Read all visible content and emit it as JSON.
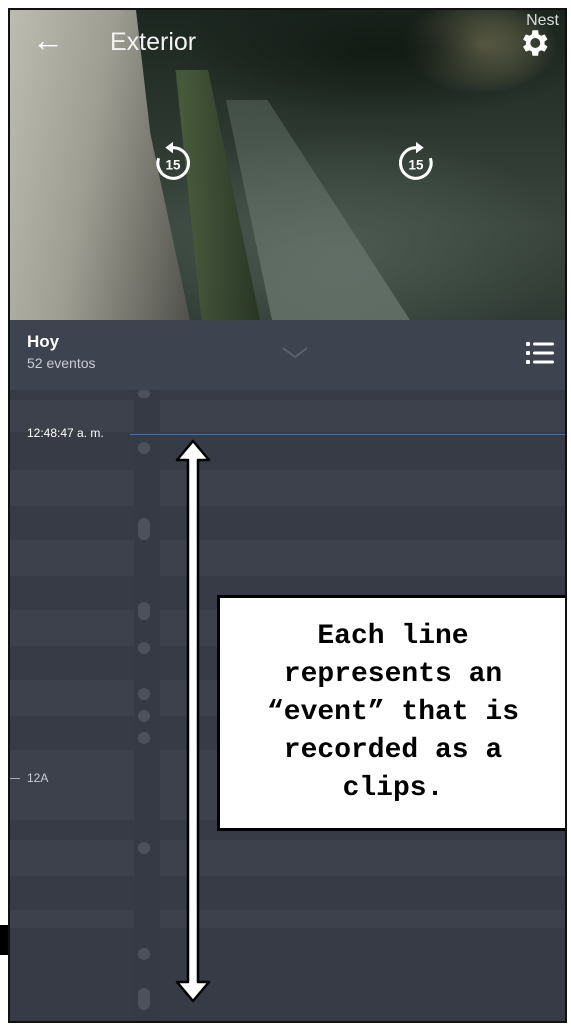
{
  "camera": {
    "title": "Exterior",
    "brand": "Nest",
    "icons": {
      "back": "back-arrow-icon",
      "settings": "gear-icon",
      "skip_back": "replay-15-icon",
      "skip_forward": "forward-15-icon"
    },
    "skip_back_label": "15",
    "skip_forward_label": "15"
  },
  "header": {
    "day": "Hoy",
    "event_count": "52 eventos",
    "icons": {
      "expand": "chevron-down-icon",
      "list": "list-icon"
    }
  },
  "timeline": {
    "current_time": "12:48:47 a. m.",
    "hour_marker": "12A",
    "colors": {
      "now_line": "#3b73c4",
      "background": "#363b46"
    }
  },
  "annotation": {
    "text": "Each line represents an “event” that is recorded as a clips."
  }
}
